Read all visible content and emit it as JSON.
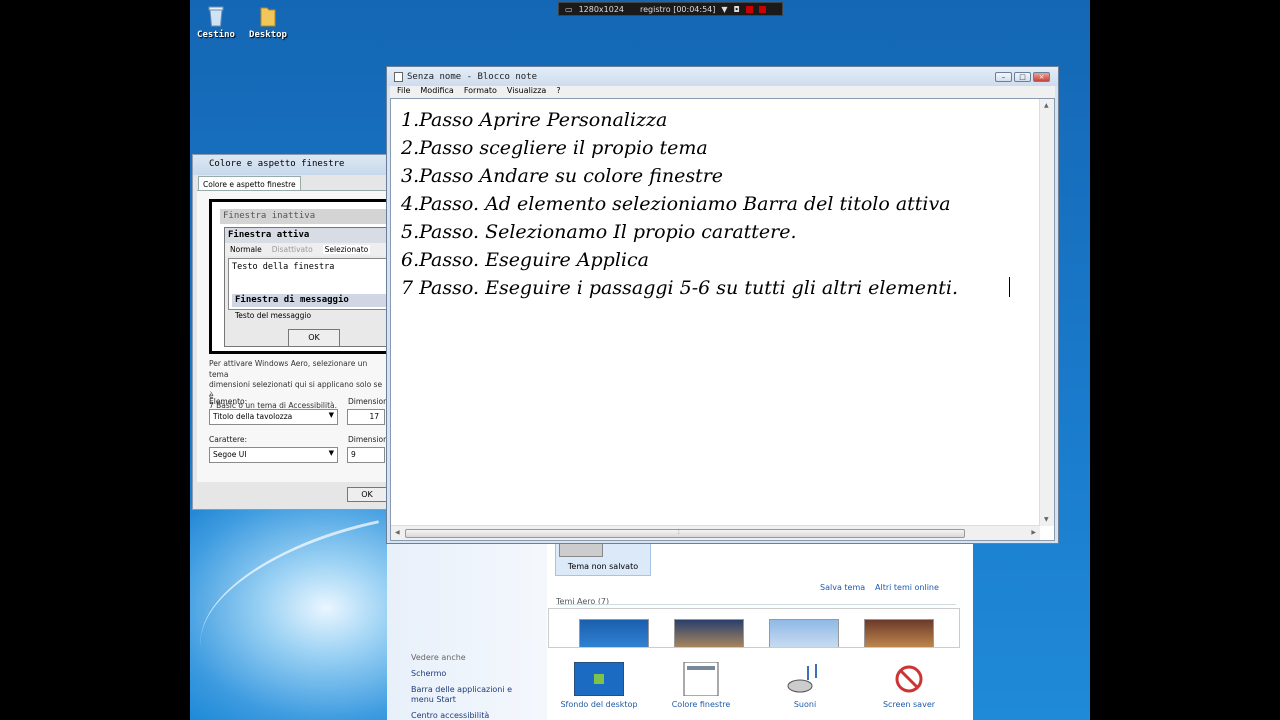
{
  "desktop": {
    "icons": [
      {
        "label": "Cestino",
        "icon": "recycle-bin-icon"
      },
      {
        "label": "Desktop",
        "icon": "folder-icon"
      }
    ]
  },
  "recorder": {
    "resolution": "1280x1024",
    "status": "registro [00:04:54]"
  },
  "color_window": {
    "title": "Colore e aspetto finestre",
    "tab": "Colore e aspetto finestre",
    "preview": {
      "inactive": "Finestra inattiva",
      "active": "Finestra attiva",
      "menu_normal": "Normale",
      "menu_disabled": "Disattivato",
      "menu_selected": "Selezionato",
      "window_text": "Testo della finestra",
      "message_title": "Finestra di messaggio",
      "message_text": "Testo del messaggio",
      "ok": "OK"
    },
    "info_lines": [
      "Per attivare Windows Aero, selezionare un tema",
      "dimensioni selezionati qui si applicano solo se è",
      "7 Basic o un tema di Accessibilità."
    ],
    "element_label": "Elemento:",
    "element_value": "Titolo della tavolozza",
    "size_label_1": "Dimension",
    "size_value_1": "17",
    "font_label": "Carattere:",
    "font_value": "Segoe UI",
    "size_label_2": "Dimension",
    "size_value_2": "9",
    "ok_button": "OK"
  },
  "notepad": {
    "title": "Senza nome - Blocco note",
    "menu": [
      "File",
      "Modifica",
      "Formato",
      "Visualizza",
      "?"
    ],
    "lines": [
      "1.Passo Aprire Personalizza",
      "2.Passo scegliere il propio tema",
      "3.Passo Andare su colore finestre",
      "4.Passo. Ad elemento selezioniamo Barra del titolo attiva",
      "5.Passo. Selezionamo Il propio carattere.",
      "6.Passo. Eseguire Applica",
      "7 Passo. Eseguire i passaggi 5-6 su tutti gli altri elementi."
    ]
  },
  "personalize": {
    "see_also": "Vedere anche",
    "side_links": [
      "Schermo",
      "Barra delle applicazioni e menu Start",
      "Centro accessibilità"
    ],
    "unsaved_theme": "Tema non salvato",
    "save_theme": "Salva tema",
    "more_themes": "Altri temi online",
    "aero_header": "Temi Aero (7)",
    "bottom_items": [
      "Sfondo del desktop",
      "Colore finestre",
      "Suoni",
      "Screen saver"
    ]
  }
}
